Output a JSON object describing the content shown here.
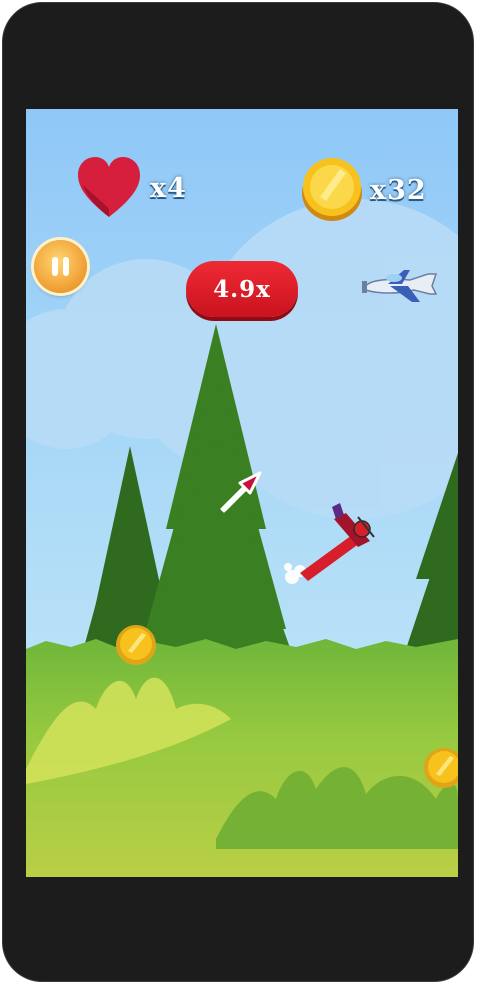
{
  "hud": {
    "lives_count": "x4",
    "coins_count": "x32",
    "multiplier": "4.9x"
  },
  "icons": {
    "heart": "heart-icon",
    "coin": "coin-icon",
    "pause": "pause-icon",
    "arrow": "direction-arrow-icon"
  },
  "colors": {
    "sky": "#87c7f4",
    "grass": "#8cc63f",
    "multiplier_badge": "#e0202b",
    "heart": "#d61f3d",
    "coin": "#f7c21d",
    "phone_frame": "#1c1c1c"
  }
}
